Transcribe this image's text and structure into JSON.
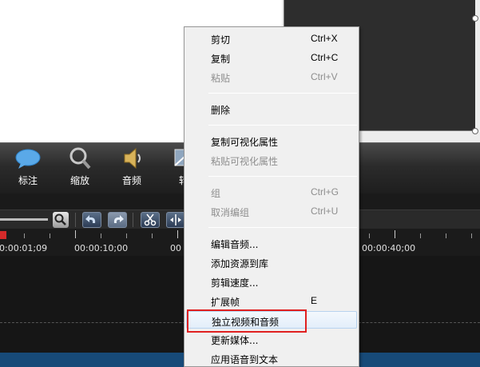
{
  "tools": [
    {
      "label": "标注",
      "icon": "callout-icon"
    },
    {
      "label": "缩放",
      "icon": "zoom-icon"
    },
    {
      "label": "音频",
      "icon": "audio-speaker-icon"
    },
    {
      "label": "转",
      "icon": "transition-icon"
    }
  ],
  "ruler": {
    "labels": [
      "0:00:01;09",
      "00:00:10;00",
      "00",
      "00:00:40;00"
    ]
  },
  "context_menu": {
    "items": [
      {
        "label": "剪切",
        "shortcut": "Ctrl+X",
        "enabled": true
      },
      {
        "label": "复制",
        "shortcut": "Ctrl+C",
        "enabled": true
      },
      {
        "label": "粘贴",
        "shortcut": "Ctrl+V",
        "enabled": false
      },
      {
        "label": "删除",
        "shortcut": "",
        "enabled": true
      },
      {
        "label": "复制可视化属性",
        "shortcut": "",
        "enabled": true
      },
      {
        "label": "粘贴可视化属性",
        "shortcut": "",
        "enabled": false
      },
      {
        "label": "组",
        "shortcut": "Ctrl+G",
        "enabled": false
      },
      {
        "label": "取消编组",
        "shortcut": "Ctrl+U",
        "enabled": false
      },
      {
        "label": "编辑音频...",
        "shortcut": "",
        "enabled": true
      },
      {
        "label": "添加资源到库",
        "shortcut": "",
        "enabled": true
      },
      {
        "label": "剪辑速度...",
        "shortcut": "",
        "enabled": true
      },
      {
        "label": "扩展帧",
        "shortcut": "E",
        "enabled": true
      },
      {
        "label": "独立视频和音频",
        "shortcut": "",
        "enabled": true,
        "hovered": true
      },
      {
        "label": "更新媒体...",
        "shortcut": "",
        "enabled": true
      },
      {
        "label": "应用语音到文本",
        "shortcut": "",
        "enabled": true
      }
    ]
  },
  "colors": {
    "highlight_box": "#e02020",
    "timeline_band": "#174a78",
    "playhead": "#d42a2a"
  }
}
